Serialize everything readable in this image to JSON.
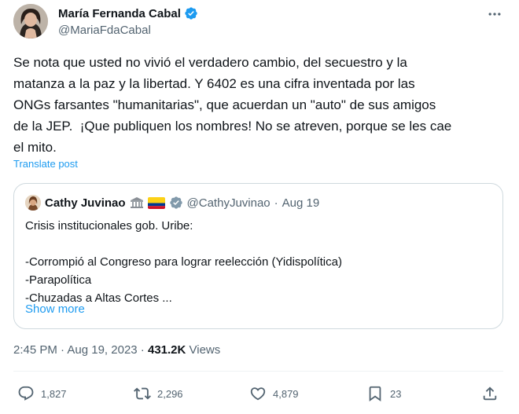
{
  "author": {
    "display_name": "María Fernanda Cabal",
    "handle": "@MariaFdaCabal"
  },
  "tweet": {
    "text": "Se nota que usted no vivió el verdadero cambio, del secuestro y la\nmatanza a la paz y la libertad. Y 6402 es una cifra inventada por las\nONGs farsantes \"humanitarias\", que acuerdan un \"auto\" de sus amigos\nde la JEP.  ¡Que publiquen los nombres! No se atreven, porque se les cae\nel mito.",
    "translate_label": "Translate post"
  },
  "quote": {
    "display_name": "Cathy Juvinao",
    "handle": "@CathyJuvinao",
    "separator": "·",
    "date": "Aug 19",
    "text": "Crisis institucionales gob. Uribe:\n\n-Corrompió al Congreso para lograr reelección (Yidispolítica)\n-Parapolítica\n-Chuzadas a Altas Cortes ...",
    "show_more_label": "Show more"
  },
  "meta": {
    "time": "2:45 PM",
    "separator1": " · ",
    "date": "Aug 19, 2023",
    "separator2": " · ",
    "views_count": "431.2K",
    "views_label": " Views"
  },
  "actions": {
    "replies": "1,827",
    "reposts": "2,296",
    "likes": "4,879",
    "bookmarks": "23"
  },
  "colors": {
    "accent": "#1d9bf0",
    "secondary_text": "#536471",
    "primary_text": "#0f1419",
    "border": "#cfd9de"
  },
  "icons": {
    "more": "more-horizontal-icon",
    "verified": "verified-badge-icon",
    "reply": "reply-icon",
    "repost": "repost-icon",
    "like": "heart-icon",
    "bookmark": "bookmark-icon",
    "share": "share-icon"
  }
}
